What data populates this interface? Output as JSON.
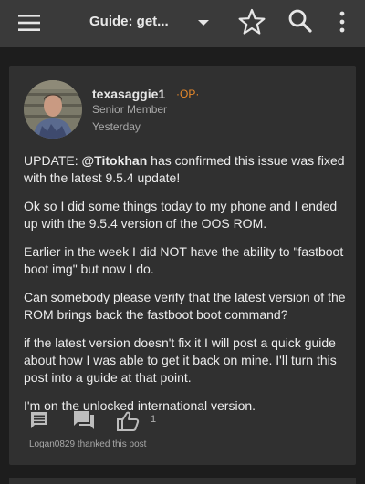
{
  "header": {
    "title": "Guide: get..."
  },
  "post": {
    "username": "texasaggie1",
    "badge": "·OP·",
    "user_title": "Senior Member",
    "date": "Yesterday",
    "body": {
      "p1_prefix": "UPDATE: ",
      "p1_mention": "@Titokhan",
      "p1_suffix": " has confirmed this issue was fixed with the latest 9.5.4 update!",
      "p2": "Ok so I did some things today to my phone and I ended up with the 9.5.4 version of the OOS ROM.",
      "p3": "Earlier in the week I did NOT have the ability to \"fastboot boot img\" but now I do.",
      "p4": "Can somebody please verify that the latest version of the ROM brings back the fastboot boot command?",
      "p5": "if the latest version doesn't fix it I will post a quick guide about how I was able to get it back on mine. I'll turn this post into a guide at that point.",
      "p6": "I'm on the unlocked international version."
    },
    "thanks_count": "1",
    "thanked_by": "Logan0829 thanked this post"
  },
  "icons": {
    "menu": "hamburger-menu-icon",
    "dropdown": "caret-down-icon",
    "favorite": "star-outline-icon",
    "search": "search-icon",
    "more": "more-vertical-icon",
    "reply": "reply-comment-icon",
    "quote": "quote-icon",
    "thanks": "thumbs-up-icon"
  },
  "colors": {
    "background": "#1d1d1d",
    "topbar": "#3a3a3a",
    "card": "#303030",
    "accent_op": "#e8892a"
  }
}
